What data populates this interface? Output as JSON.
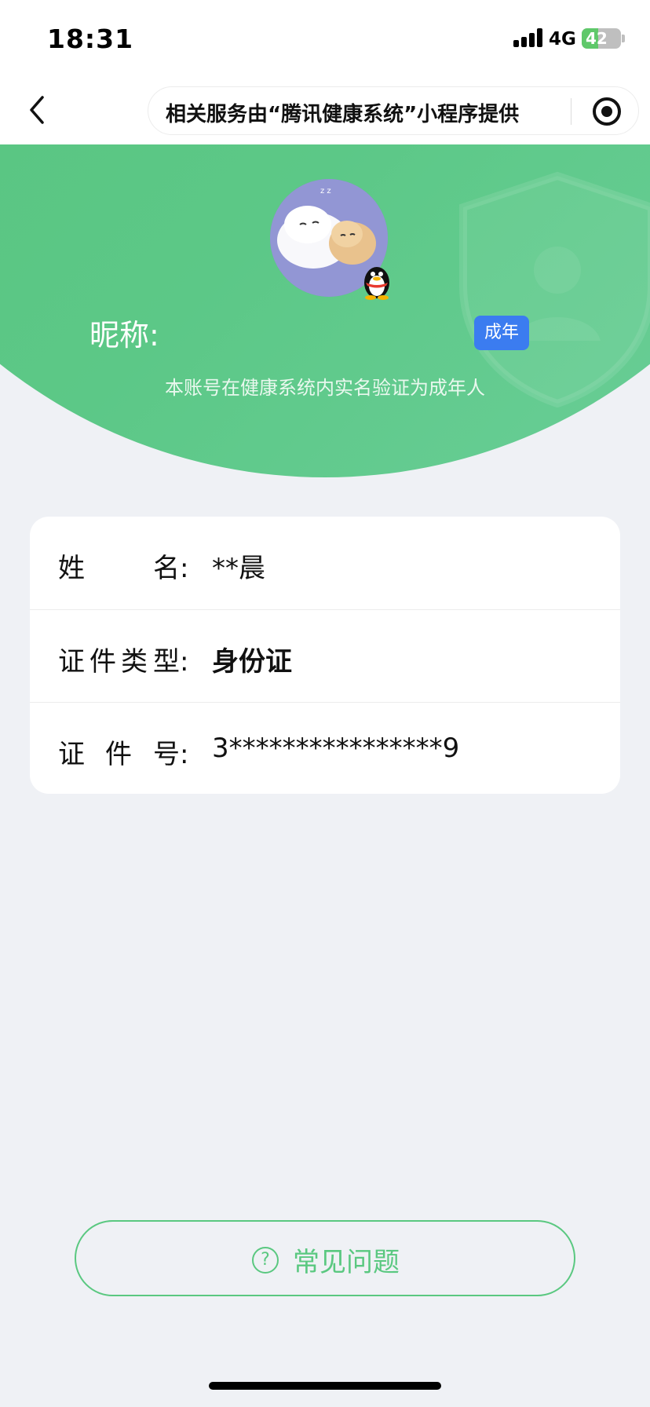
{
  "status_bar": {
    "time": "18:31",
    "network": "4G",
    "battery_level": "42",
    "battery_fraction": 0.42,
    "charging": true
  },
  "nav": {
    "back_icon": "chevron-left-icon",
    "capsule_text": "相关服务由“腾讯健康系统”小程序提供",
    "record_icon": "target-record-icon"
  },
  "profile": {
    "nickname_label": "昵称:",
    "badge": "成年",
    "description": "本账号在健康系统内实名验证为成年人"
  },
  "info": {
    "rows": [
      {
        "label_chars": [
          "姓",
          "名:"
        ],
        "value": "**晨",
        "bold": false
      },
      {
        "label_chars": [
          "证",
          "件",
          "类",
          "型:"
        ],
        "value": "身份证",
        "bold": true
      },
      {
        "label_chars": [
          "证",
          "件",
          "号:"
        ],
        "value": "3****************9",
        "bold": false
      }
    ]
  },
  "faq": {
    "icon_glyph": "?",
    "label": "常见问题"
  },
  "colors": {
    "green": "#5ac880",
    "badge_blue": "#3b7cf0",
    "page_bg": "#eff1f5"
  }
}
